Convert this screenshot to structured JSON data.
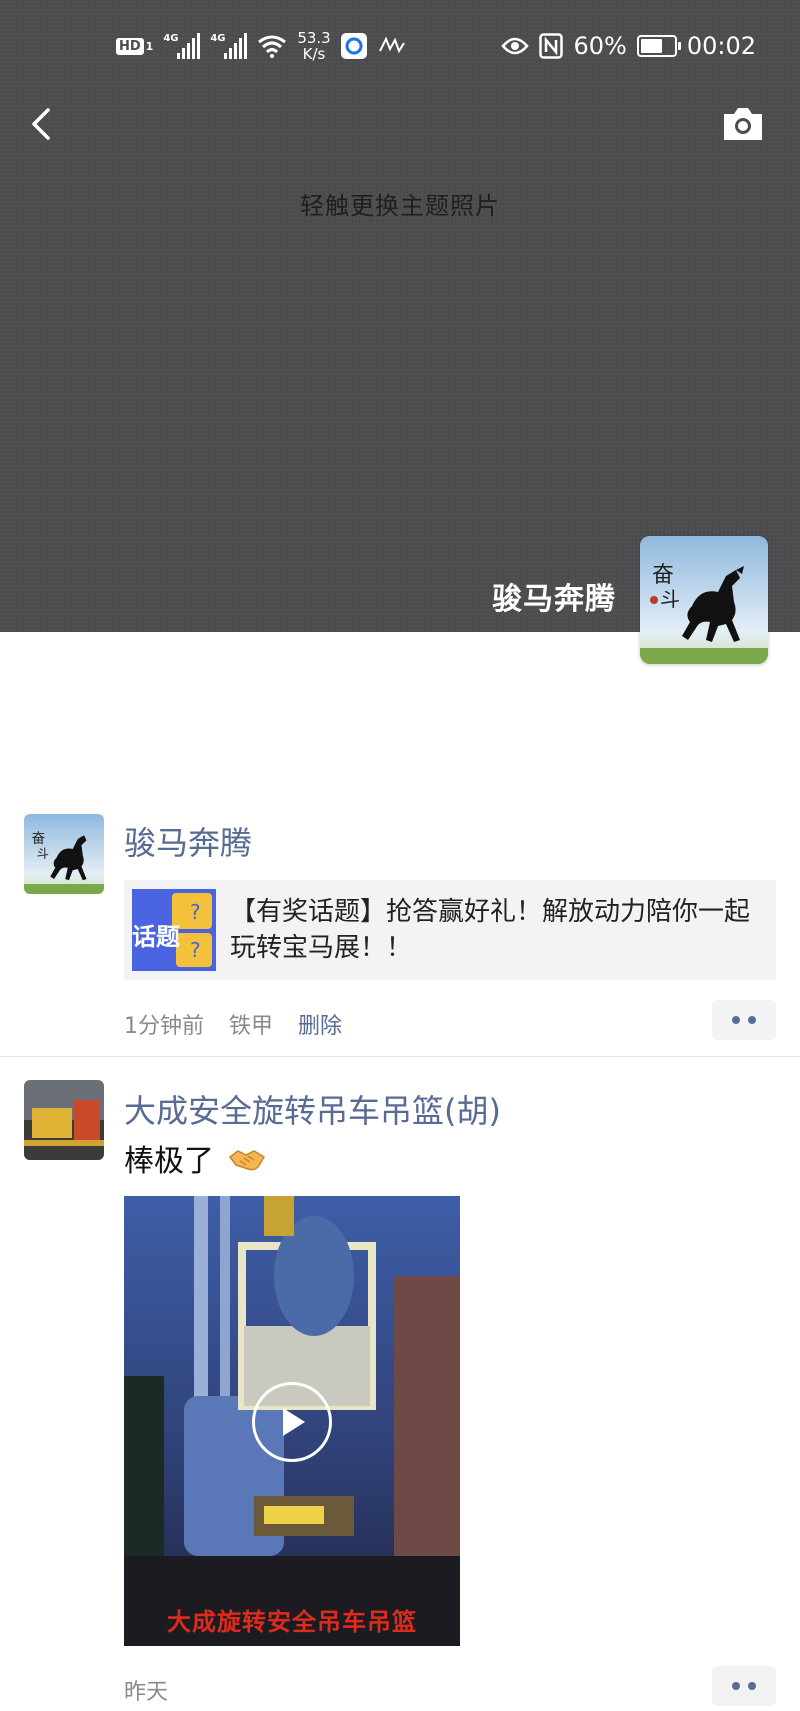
{
  "status_bar": {
    "hd_label": "HD",
    "sim": "1",
    "net1": "4G",
    "net2": "4G",
    "speed_value": "53.3",
    "speed_unit": "K/s",
    "battery": "60%",
    "time": "00:02"
  },
  "cover": {
    "hint": "轻触更换主题照片",
    "profile_name": "骏马奔腾",
    "background_color": "#4d4d4f"
  },
  "posts": [
    {
      "author": "骏马奔腾",
      "share_title": "【有奖话题】抢答赢好礼！解放动力陪你一起玩转宝马展！！",
      "share_thumb_text": "话题",
      "time": "1分钟前",
      "source": "铁甲",
      "delete_label": "删除"
    },
    {
      "author": "大成安全旋转吊车吊篮(胡)",
      "text": "棒极了",
      "video_caption": "大成旋转安全吊车吊篮",
      "time": "昨天"
    }
  ],
  "colors": {
    "link": "#576b95",
    "meta": "#8a8a8a",
    "card_bg": "#f3f3f5"
  }
}
